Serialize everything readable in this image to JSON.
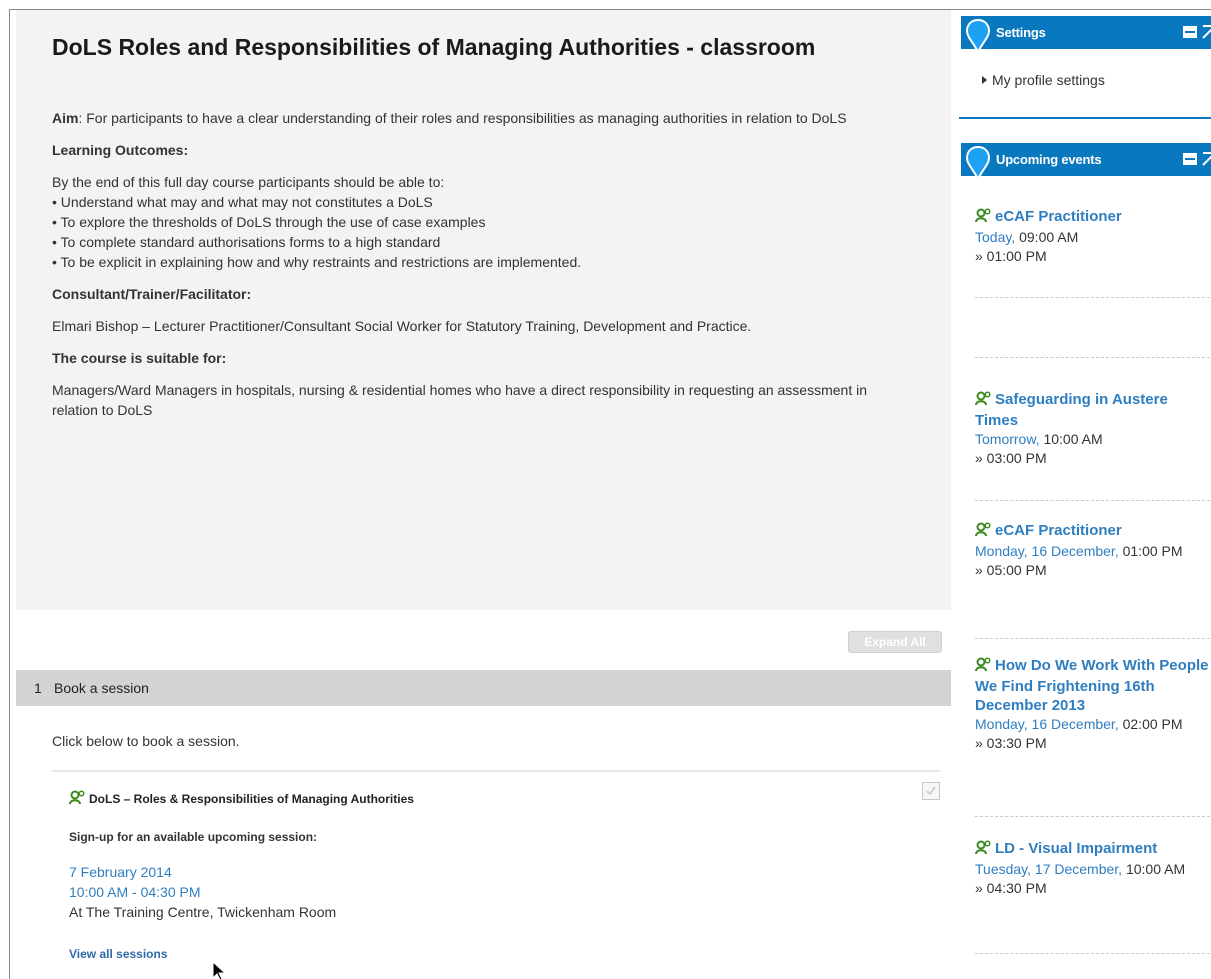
{
  "course": {
    "title": "DoLS Roles and Responsibilities of Managing Authorities - classroom",
    "aim_label": "Aim",
    "aim_text": ": For participants to have a clear understanding of their roles and responsibilities as managing authorities in relation to DoLS",
    "learning_outcomes_heading": "Learning Outcomes:",
    "intro_line": "By the end of this full day course participants should be able to:",
    "outcomes": [
      "• Understand what may and what may not constitutes a DoLS",
      "• To explore the thresholds of DoLS through the use of case examples",
      "• To complete standard authorisations forms to a high standard",
      "• To be explicit in explaining how and why restraints and restrictions are implemented."
    ],
    "trainer_heading": "Consultant/Trainer/Facilitator:",
    "trainer_text": "Elmari Bishop – Lecturer Practitioner/Consultant Social Worker for Statutory Training, Development and Practice.",
    "suitable_heading": "The course is suitable for:",
    "suitable_text": "Managers/Ward Managers in hospitals, nursing & residential homes who have a direct responsibility in requesting an assessment in relation to DoLS"
  },
  "expand_all_label": "Expand All",
  "section": {
    "number": "1",
    "name": "Book a session",
    "intro": "Click below to book a session.",
    "activity_title": "DoLS – Roles & Responsibilities of Managing Authorities",
    "signup_label": "Sign-up for an available upcoming session:",
    "session_date": "7 February 2014",
    "session_time": "10:00 AM - 04:30 PM",
    "session_location": "At The Training Centre, Twickenham Room",
    "view_all_label": "View all sessions"
  },
  "sidebar": {
    "settings": {
      "title": "Settings",
      "item": "My profile settings"
    },
    "upcoming": {
      "title": "Upcoming events",
      "events": [
        {
          "title": "eCAF Practitioner",
          "date": "Today,",
          "time": " 09:00 AM",
          "end": "» 01:00 PM"
        },
        {
          "title": "Safeguarding in Austere Times",
          "date": "Tomorrow,",
          "time": " 10:00 AM",
          "end": "» 03:00 PM"
        },
        {
          "title": "eCAF Practitioner",
          "date": "Monday, 16 December,",
          "time": " 01:00 PM",
          "end": "» 05:00 PM"
        },
        {
          "title": "How Do We Work With People We Find Frightening 16th December 2013",
          "date": "Monday, 16 December,",
          "time": " 02:00 PM",
          "end": "» 03:30 PM"
        },
        {
          "title": "LD - Visual Impairment",
          "date": "Tuesday, 17 December,",
          "time": " 10:00 AM",
          "end": "» 04:30 PM"
        }
      ]
    }
  },
  "colors": {
    "accent_blue": "#0a78be",
    "link_blue": "#2f7ec0",
    "summary_bg": "#f3f3f3",
    "section_header_bg": "#d3d3d3"
  }
}
